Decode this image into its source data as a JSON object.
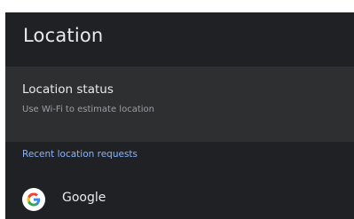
{
  "header": {
    "title": "Location"
  },
  "location_status": {
    "title": "Location status",
    "subtitle": "Use Wi-Fi to estimate location"
  },
  "recent_requests": {
    "section_label": "Recent location requests",
    "apps": [
      {
        "name": "Google",
        "icon": "google-g-icon"
      }
    ]
  },
  "colors": {
    "background": "#202124",
    "row_highlight": "#2d2f31",
    "accent": "#8ab4f8",
    "primary_text": "#e8eaed",
    "secondary_text": "#9aa0a6"
  }
}
